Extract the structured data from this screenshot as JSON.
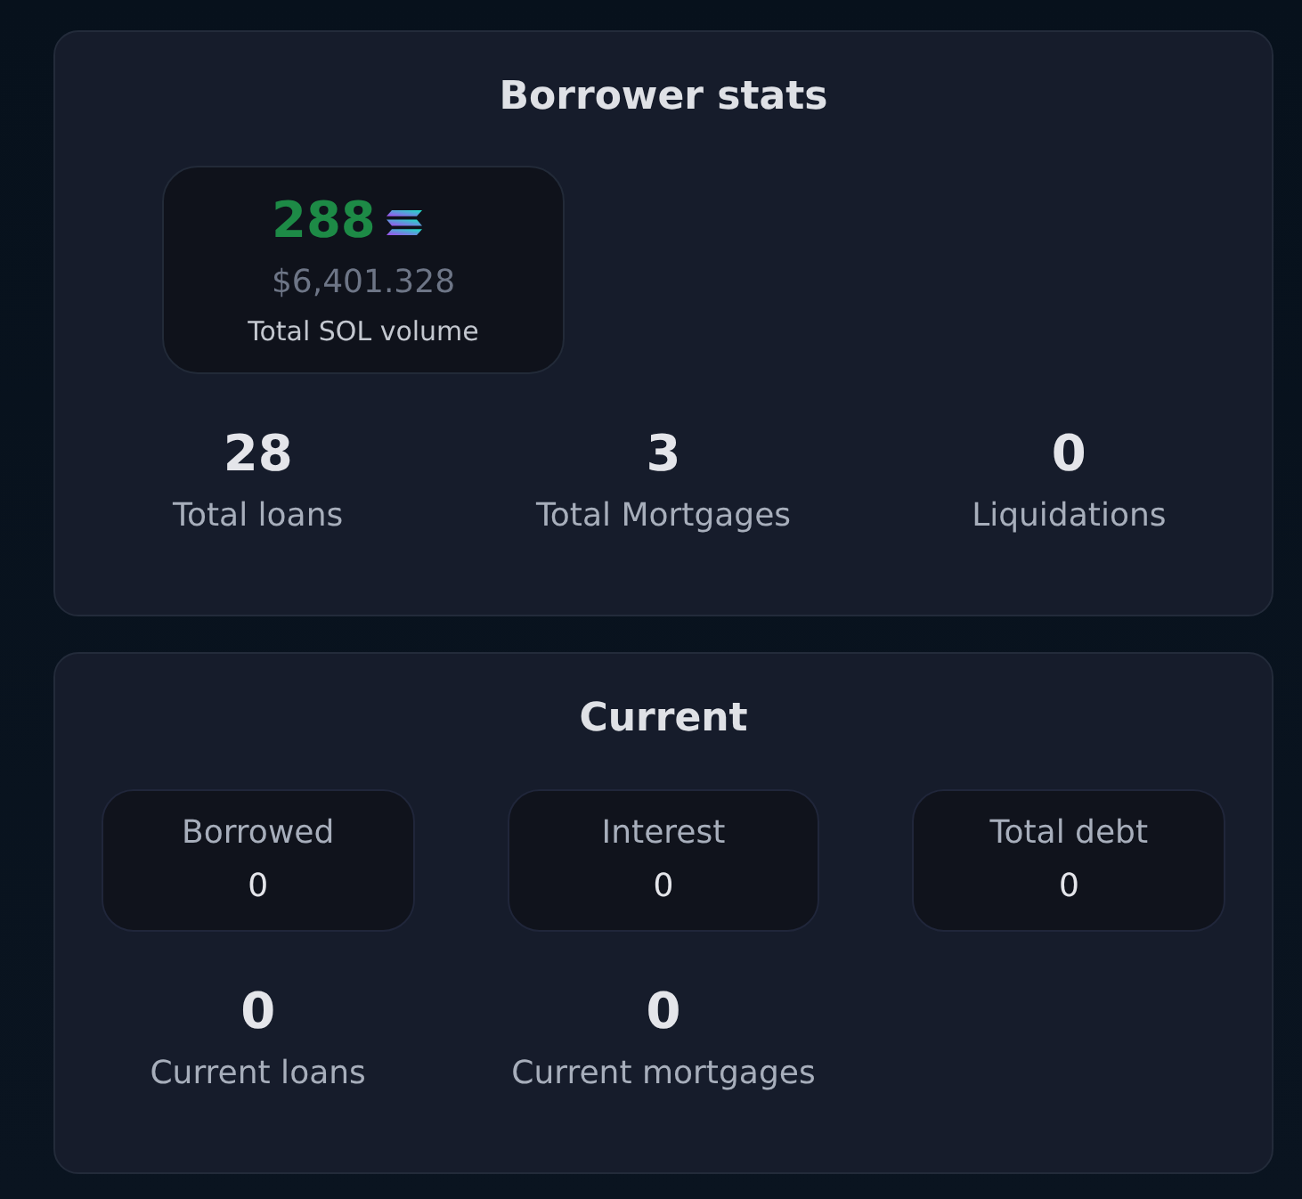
{
  "borrower_stats": {
    "title": "Borrower stats",
    "volume": {
      "amount": "288",
      "usd": "$6,401.328",
      "label": "Total SOL volume"
    },
    "stats": [
      {
        "value": "28",
        "label": "Total loans"
      },
      {
        "value": "3",
        "label": "Total Mortgages"
      },
      {
        "value": "0",
        "label": "Liquidations"
      }
    ]
  },
  "current": {
    "title": "Current",
    "tiles": [
      {
        "label": "Borrowed",
        "value": "0"
      },
      {
        "label": "Interest",
        "value": "0"
      },
      {
        "label": "Total debt",
        "value": "0"
      }
    ],
    "stats": [
      {
        "value": "0",
        "label": "Current loans"
      },
      {
        "value": "0",
        "label": "Current mortgages"
      }
    ]
  }
}
